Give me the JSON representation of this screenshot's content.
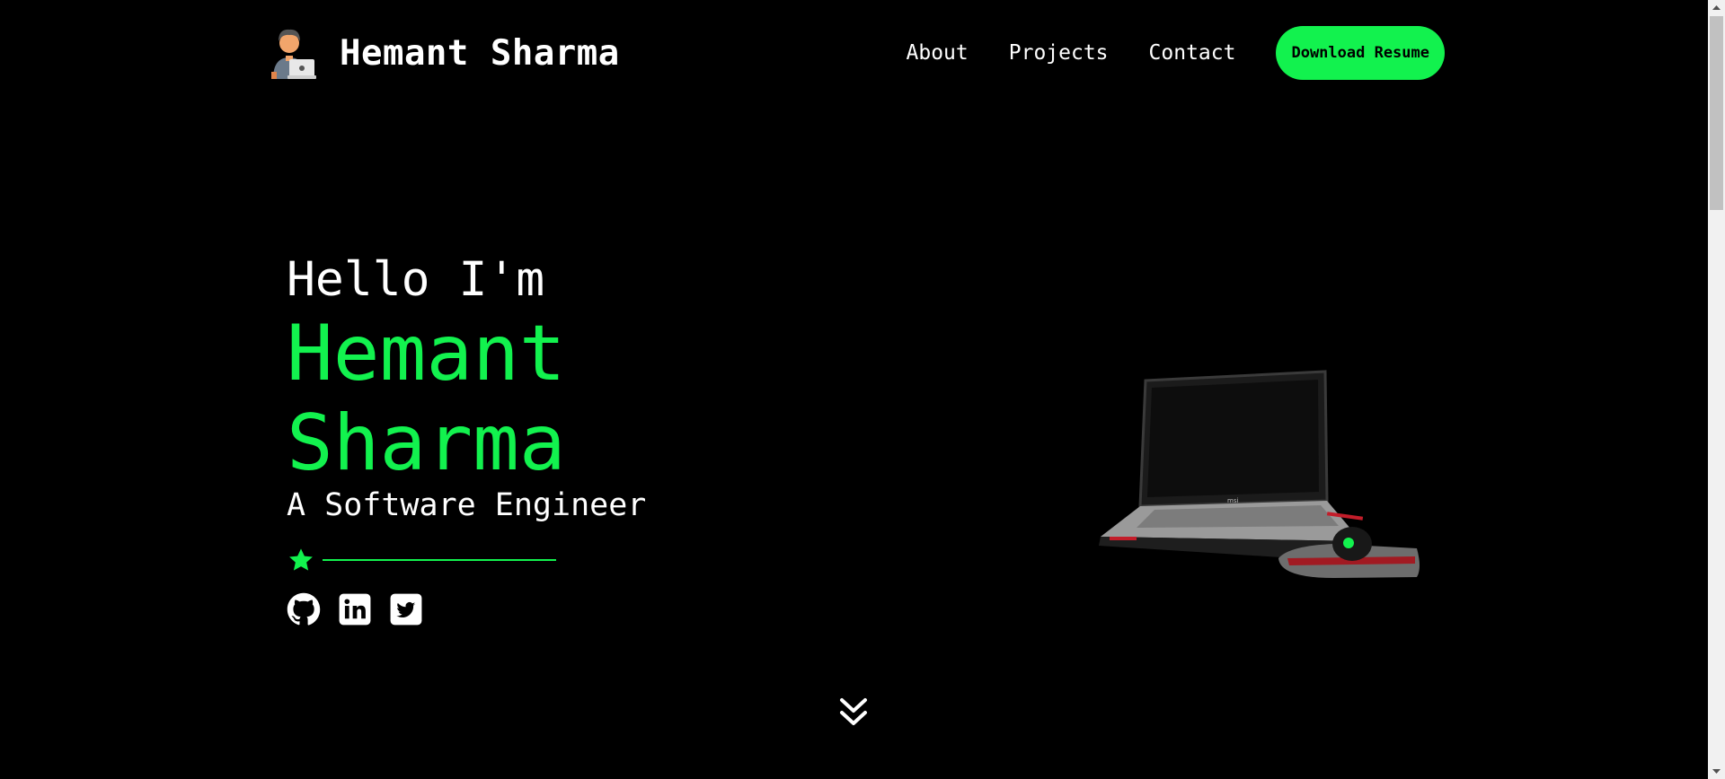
{
  "header": {
    "brand_name": "Hemant Sharma",
    "nav": [
      {
        "label": "About"
      },
      {
        "label": "Projects"
      },
      {
        "label": "Contact"
      }
    ],
    "resume_label": "Download Resume"
  },
  "hero": {
    "greeting": "Hello I'm",
    "first_name": "Hemant",
    "last_name": "Sharma",
    "tagline": "A Software Engineer"
  },
  "icons": {
    "avatar": "developer-avatar-icon",
    "divider": "star-icon",
    "socials": [
      "github-icon",
      "linkedin-icon",
      "twitter-icon"
    ],
    "scroll": "double-chevron-down-icon"
  },
  "colors": {
    "background": "#000000",
    "accent": "#12f24e",
    "text": "#ffffff"
  }
}
